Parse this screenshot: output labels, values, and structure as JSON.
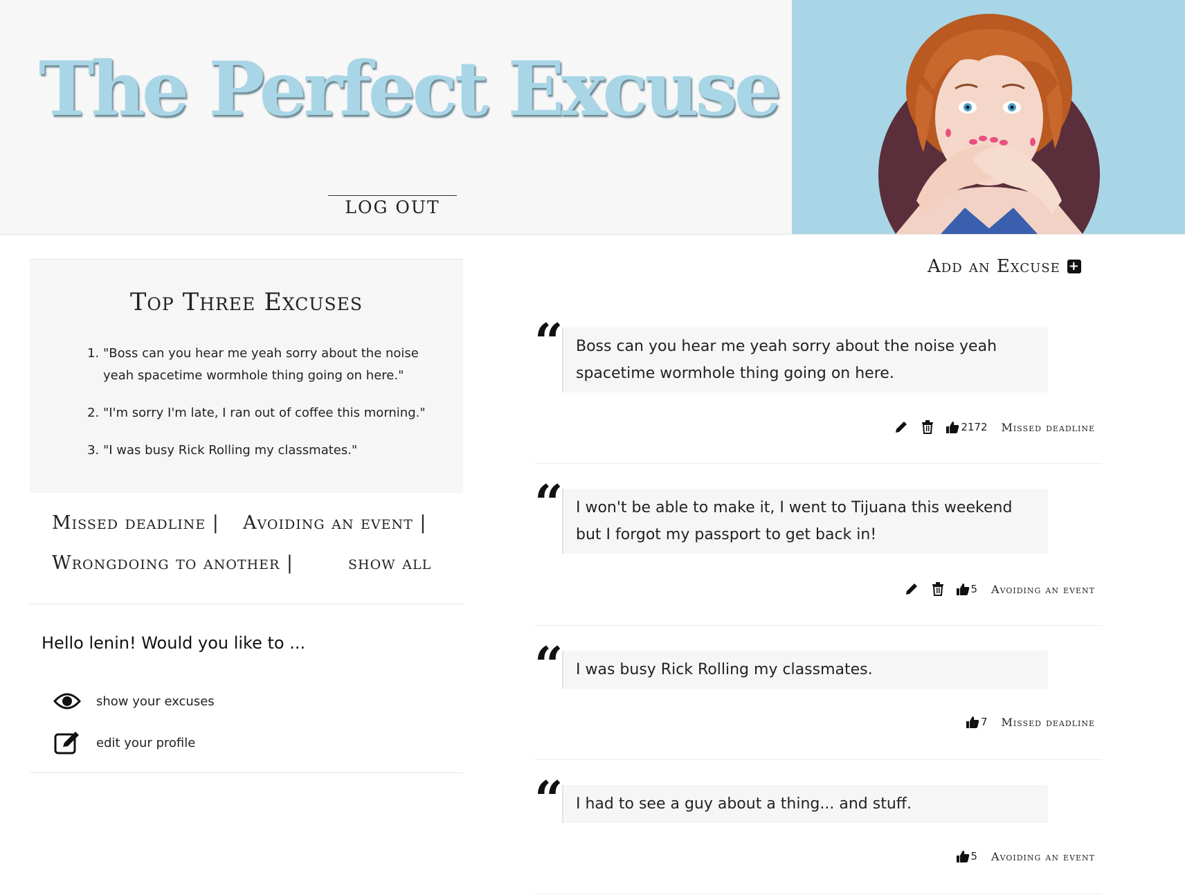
{
  "header": {
    "title": "The Perfect Excuse",
    "logout_label": "LOG OUT"
  },
  "top_excuses": {
    "heading": "Top Three Excuses",
    "items": [
      "\"Boss can you hear me yeah sorry about the noise yeah spacetime wormhole thing going on here.\"",
      "\"I'm sorry I'm late, I ran out of coffee this morning.\"",
      "\"I was busy Rick Rolling my classmates.\""
    ]
  },
  "categories": {
    "missed": "Missed deadline |",
    "avoiding": "Avoiding an event |",
    "wrongdoing": "Wrongdoing to another |",
    "show_all": "show all"
  },
  "user_panel": {
    "greeting": "Hello lenin! Would you like to ...",
    "show_label": "show your excuses",
    "edit_label": "edit your profile"
  },
  "add_excuse_label": "Add an Excuse",
  "excuses": [
    {
      "text": "Boss can you hear me yeah sorry about the noise yeah spacetime wormhole thing going on here.",
      "likes": "2172",
      "category": "Missed deadline",
      "editable": true
    },
    {
      "text": "I won't be able to make it, I went to Tijuana this weekend but I forgot my passport to get back in!",
      "likes": "5",
      "category": "Avoiding an event",
      "editable": true
    },
    {
      "text": "I was busy Rick Rolling my classmates.",
      "likes": "7",
      "category": "Missed deadline",
      "editable": false
    },
    {
      "text": "I had to see a guy about a thing... and stuff.",
      "likes": "5",
      "category": "Avoiding an event",
      "editable": false
    }
  ],
  "colors": {
    "accent_blue": "#a9d6e6",
    "panel_gray": "#f6f6f6",
    "portrait_circle": "#5a2e3a",
    "hair": "#c8682c",
    "nails": "#e8507f"
  },
  "icons": {
    "quote": "left-quote-icon",
    "edit": "pencil-icon",
    "delete": "trash-icon",
    "like": "thumbs-up-icon",
    "add": "plus-square-icon",
    "show": "eye-icon",
    "profile": "edit-square-icon"
  }
}
